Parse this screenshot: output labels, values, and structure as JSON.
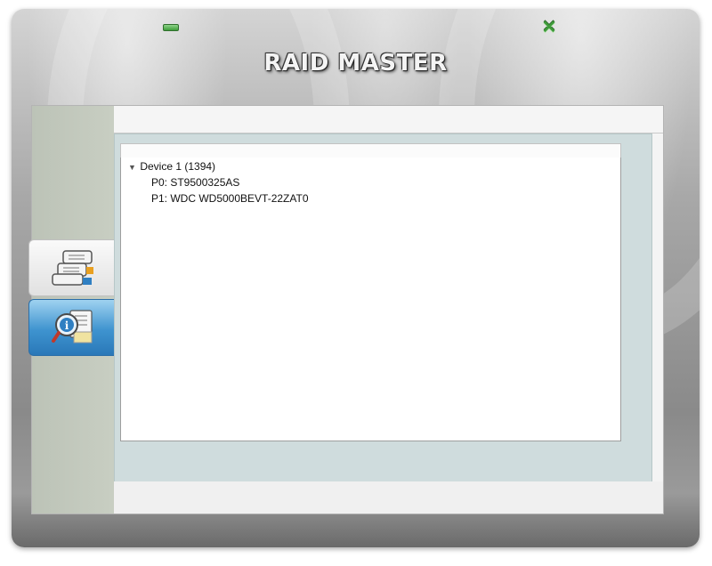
{
  "window": {
    "title": "RAID MASTER",
    "controls": {
      "minimize_icon": "minimize-icon",
      "close_icon": "close-icon",
      "close_glyph": "✕"
    }
  },
  "sidebar": {
    "items": [
      {
        "icon": "raid-disks-icon",
        "active": false
      },
      {
        "icon": "information-icon",
        "active": true
      }
    ]
  },
  "tree": {
    "device": {
      "label": "Device 1 (1394)",
      "expanded": true,
      "disclosure": "▼"
    },
    "children": [
      {
        "label": "P0: ST9500325AS"
      },
      {
        "label": "P1: WDC WD5000BEVT-22ZAT0"
      }
    ]
  },
  "colors": {
    "accent_blue": "#3e93cf",
    "control_green": "#3f9a3a",
    "panel_teal": "#cfdcdd",
    "sidebar_gray": "#c2c9bd"
  }
}
